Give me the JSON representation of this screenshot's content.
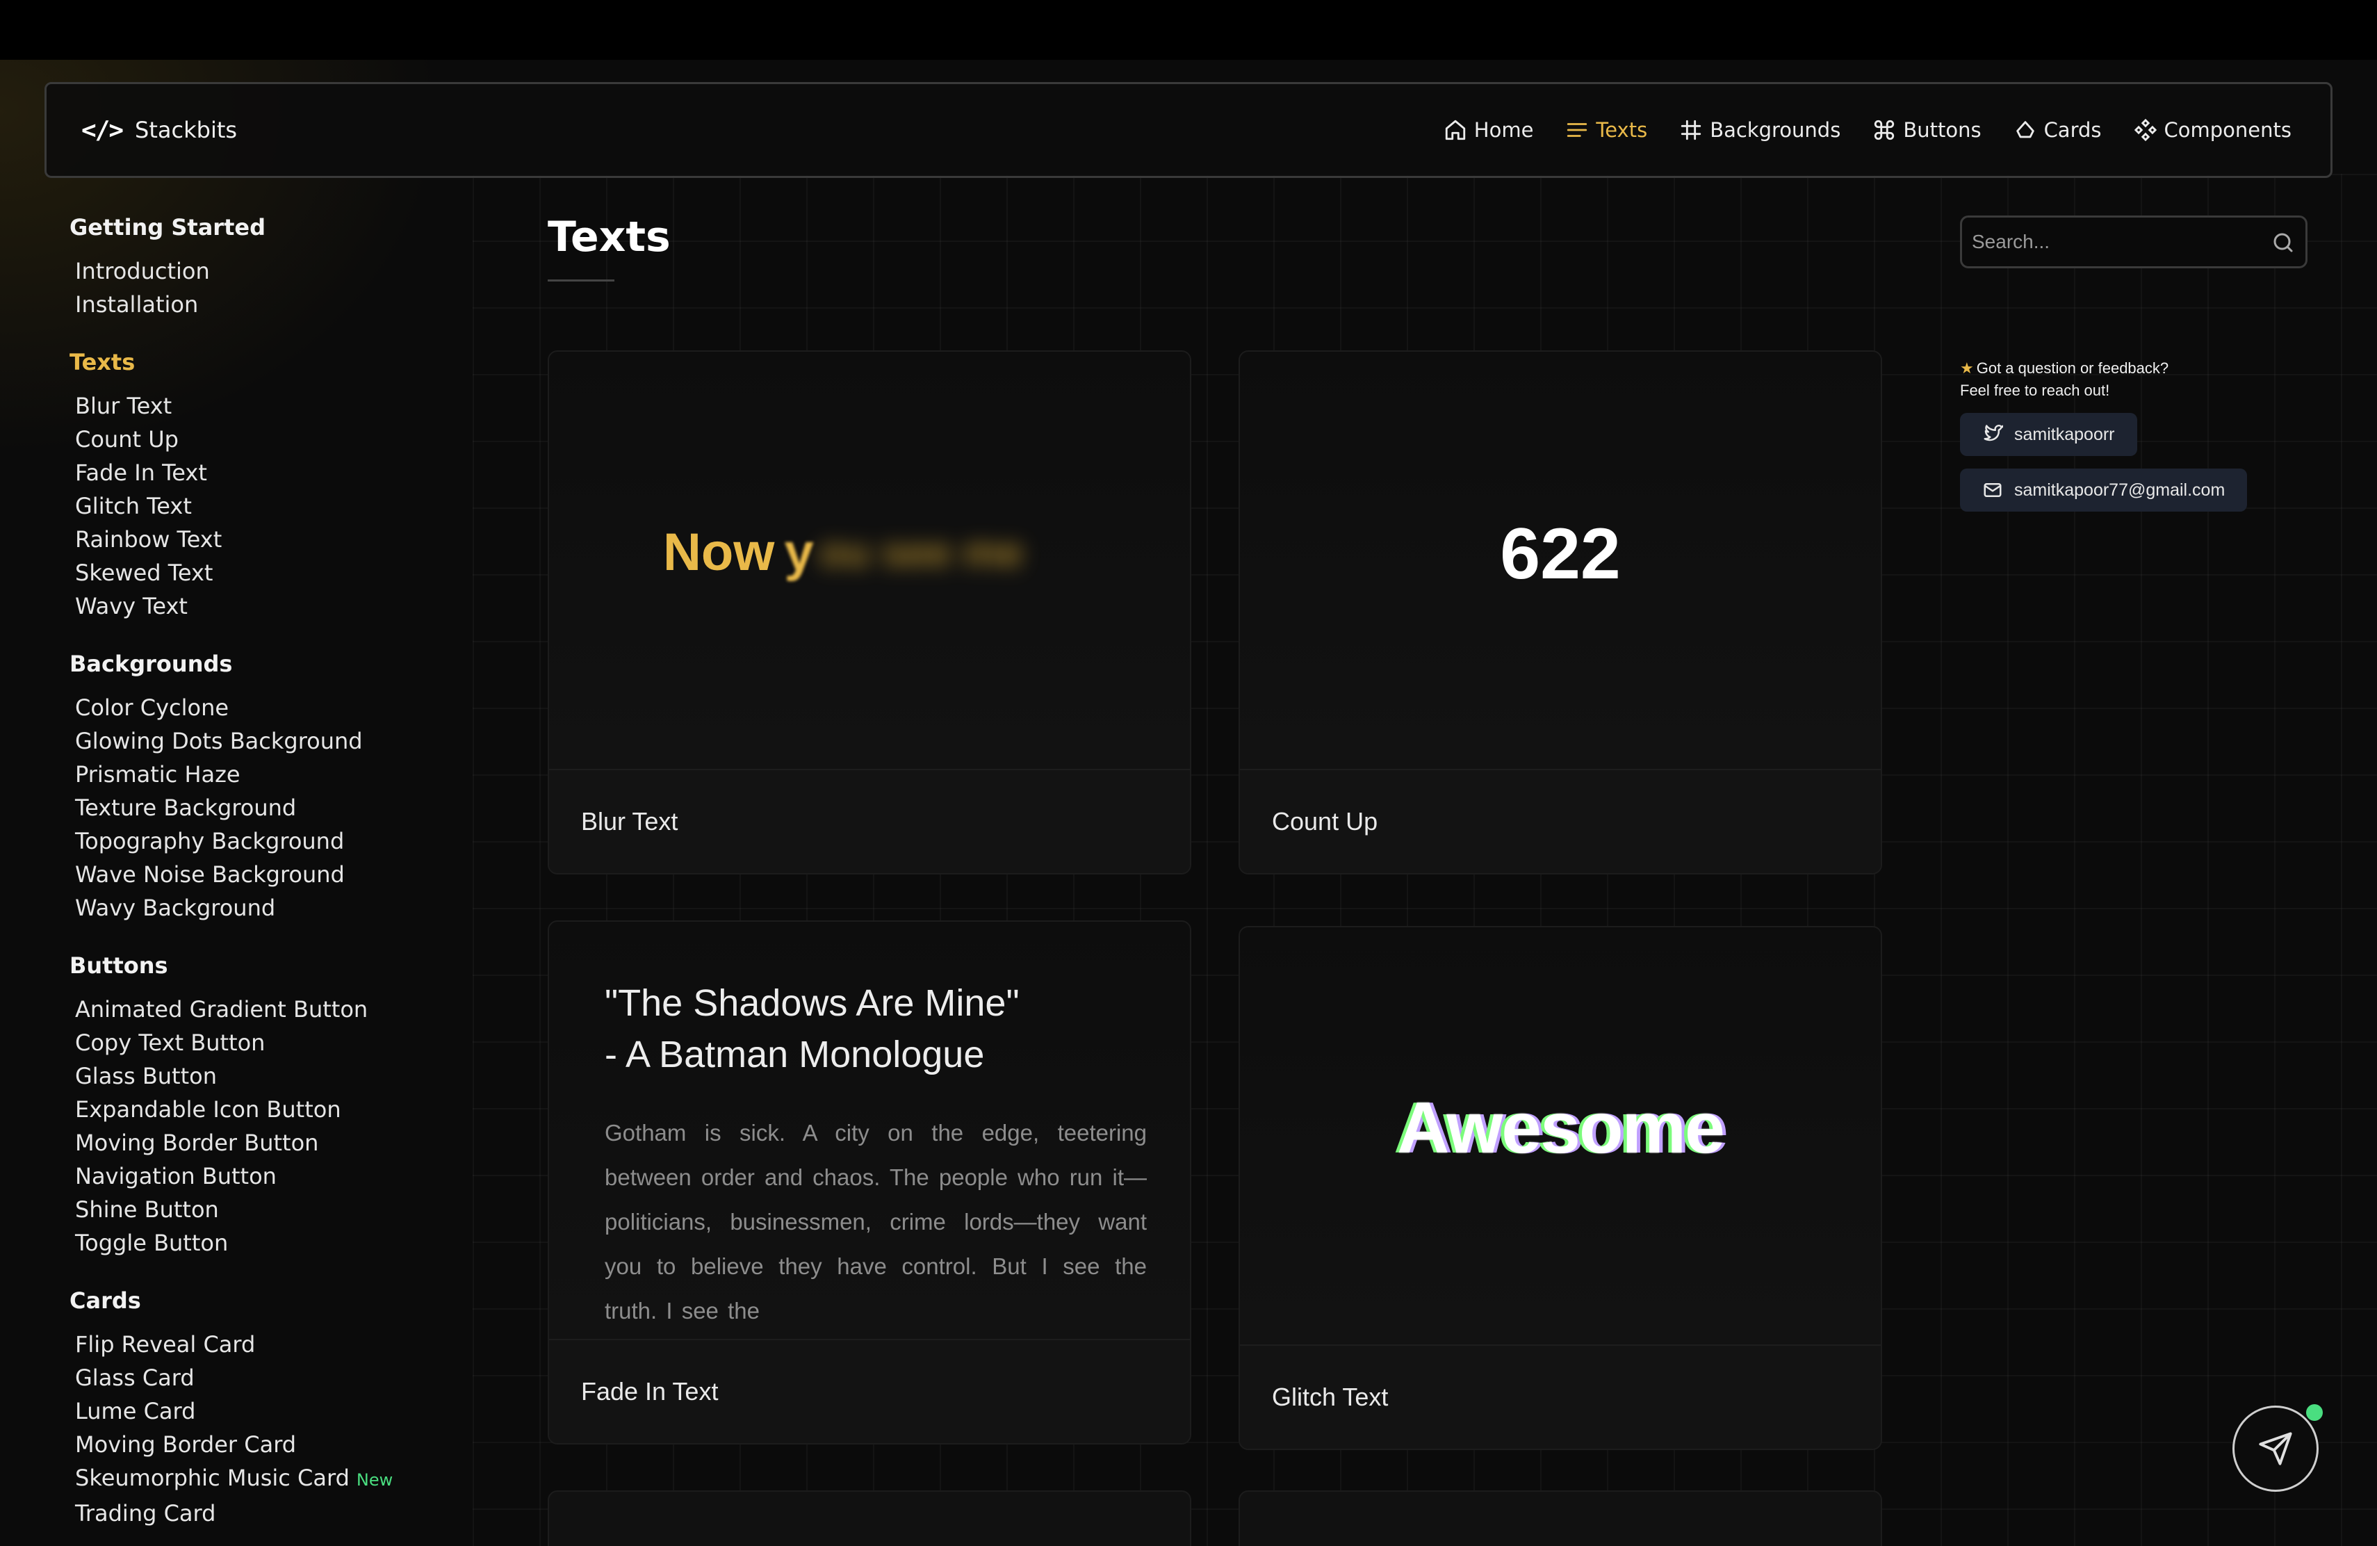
{
  "brand": {
    "icon": "</>",
    "name": "Stackbits"
  },
  "nav": [
    {
      "label": "Home",
      "icon": "home-icon",
      "active": false
    },
    {
      "label": "Texts",
      "icon": "menu-lines-icon",
      "active": true
    },
    {
      "label": "Backgrounds",
      "icon": "hash-icon",
      "active": false
    },
    {
      "label": "Buttons",
      "icon": "command-icon",
      "active": false
    },
    {
      "label": "Cards",
      "icon": "cloud-icon",
      "active": false
    },
    {
      "label": "Components",
      "icon": "component-icon",
      "active": false
    }
  ],
  "sidebar": {
    "groups": [
      {
        "heading": "Getting Started",
        "active": false,
        "items": [
          "Introduction",
          "Installation"
        ]
      },
      {
        "heading": "Texts",
        "active": true,
        "items": [
          "Blur Text",
          "Count Up",
          "Fade In Text",
          "Glitch Text",
          "Rainbow Text",
          "Skewed Text",
          "Wavy Text"
        ]
      },
      {
        "heading": "Backgrounds",
        "active": false,
        "items": [
          "Color Cyclone",
          "Glowing Dots Background",
          "Prismatic Haze",
          "Texture Background",
          "Topography Background",
          "Wave Noise Background",
          "Wavy Background"
        ]
      },
      {
        "heading": "Buttons",
        "active": false,
        "items": [
          "Animated Gradient Button",
          "Copy Text Button",
          "Glass Button",
          "Expandable Icon Button",
          "Moving Border Button",
          "Navigation Button",
          "Shine Button",
          "Toggle Button"
        ]
      },
      {
        "heading": "Cards",
        "active": false,
        "items": [
          "Flip Reveal Card",
          "Glass Card",
          "Lume Card",
          "Moving Border Card",
          "Skeumorphic Music Card",
          "Trading Card"
        ]
      }
    ],
    "new_badge": "New"
  },
  "main": {
    "title": "Texts",
    "search_placeholder": "Search...",
    "cards": [
      {
        "label": "Blur Text",
        "preview": {
          "now": "Now",
          "y": "y",
          "blurred": "ou see me"
        }
      },
      {
        "label": "Count Up",
        "preview": {
          "number": "622"
        }
      },
      {
        "label": "Fade In Text",
        "preview": {
          "title_line1": "\"The Shadows Are Mine\"",
          "title_line2": "- A Batman Monologue",
          "body": "Gotham is sick. A city on the edge, teetering between order and chaos. The people who run it—politicians, businessmen, crime lords—they want you to believe they have control. But I see the truth. I see the"
        }
      },
      {
        "label": "Glitch Text",
        "preview": {
          "word": "Awesome"
        }
      }
    ]
  },
  "contact": {
    "line1": "Got a question or feedback?",
    "line2": "Feel free to reach out!",
    "twitter": "samitkapoorr",
    "email": "samitkapoor77@gmail.com"
  },
  "colors": {
    "accent": "#e9b949",
    "status_dot": "#4ade80",
    "background": "#0b0b0b"
  }
}
